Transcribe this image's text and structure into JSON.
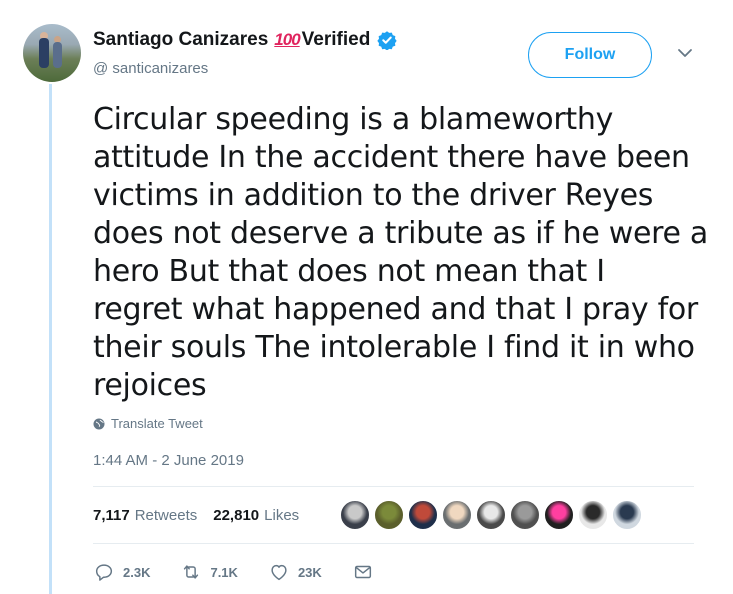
{
  "user": {
    "display_name": "Santiago Canizares",
    "emoji": "100",
    "verified_label": "Verified",
    "handle": "@ santicanizares"
  },
  "follow_label": "Follow",
  "tweet": {
    "lines": [
      "Circular speeding is a blameworthy",
      "attitude In the accident there have been",
      "victims in addition to the driver Reyes",
      "does not deserve a tribute as if he were a",
      "hero But that does not mean that I",
      "regret what happened and that I pray for",
      "their souls The intolerable I find it in who",
      "rejoices"
    ]
  },
  "translate_label": "Translate Tweet",
  "timestamp": "1:44 AM - 2 June 2019",
  "stats": {
    "retweets_count": "7,117",
    "retweets_label": "Retweets",
    "likes_count": "22,810",
    "likes_label": "Likes"
  },
  "likers": [
    {
      "color": "#3a3f4a",
      "accent": "#c9c9c9"
    },
    {
      "color": "#5b5f2c",
      "accent": "#7b8a3a"
    },
    {
      "color": "#1f2f4a",
      "accent": "#c04a3a"
    },
    {
      "color": "#6a6e70",
      "accent": "#f0d8c0"
    },
    {
      "color": "#4a4a4a",
      "accent": "#e8e8e8"
    },
    {
      "color": "#505050",
      "accent": "#9a9a9a"
    },
    {
      "color": "#202020",
      "accent": "#ff3fa0"
    },
    {
      "color": "#e8e8e8",
      "accent": "#2a2a2a"
    },
    {
      "color": "#d0d8e0",
      "accent": "#2a3a50"
    }
  ],
  "actions": {
    "reply_count": "2.3K",
    "retweet_count": "7.1K",
    "like_count": "23K"
  },
  "colors": {
    "accent": "#1da1f2",
    "muted": "#657786",
    "text": "#14171a",
    "thread_line": "#c3e1f9"
  }
}
